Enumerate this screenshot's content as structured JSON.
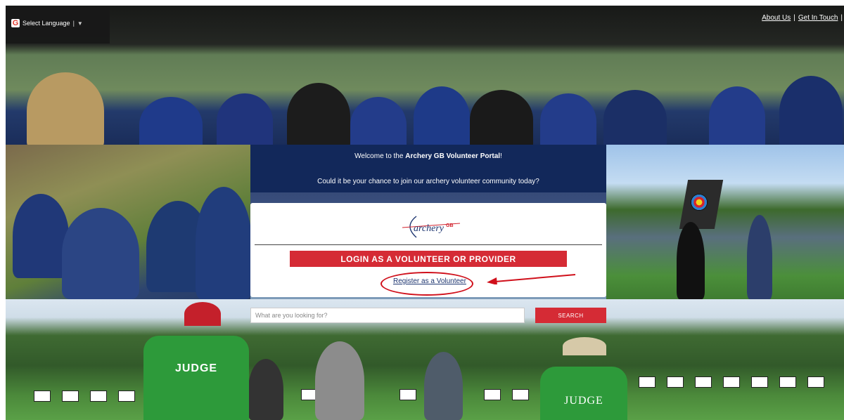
{
  "topbar": {
    "language_label": "Select Language",
    "language_separator": "|",
    "language_caret": "▼",
    "google_icon": "G",
    "links": [
      {
        "label": "About Us"
      },
      {
        "label": "Get In Touch"
      }
    ],
    "link_divider": "|",
    "trailing_divider": "|"
  },
  "welcome": {
    "line1_prefix": "Welcome to the ",
    "line1_bold": "Archery GB Volunteer Portal",
    "line1_suffix": "!",
    "line2": "Could it be your chance to join our archery volunteer community today?"
  },
  "card": {
    "logo_word": "archery",
    "logo_gb": "GB",
    "login_label": "LOGIN AS A VOLUNTEER OR PROVIDER",
    "register_label": "Register as a Volunteer"
  },
  "search": {
    "placeholder": "What are you looking for?",
    "button_label": "SEARCH"
  },
  "photo": {
    "jersey_left": "JUDGE",
    "jersey_right": "JUDGE"
  },
  "colors": {
    "brand_navy": "#12285a",
    "brand_red": "#d52b35",
    "annotation_red": "#d0101b"
  }
}
